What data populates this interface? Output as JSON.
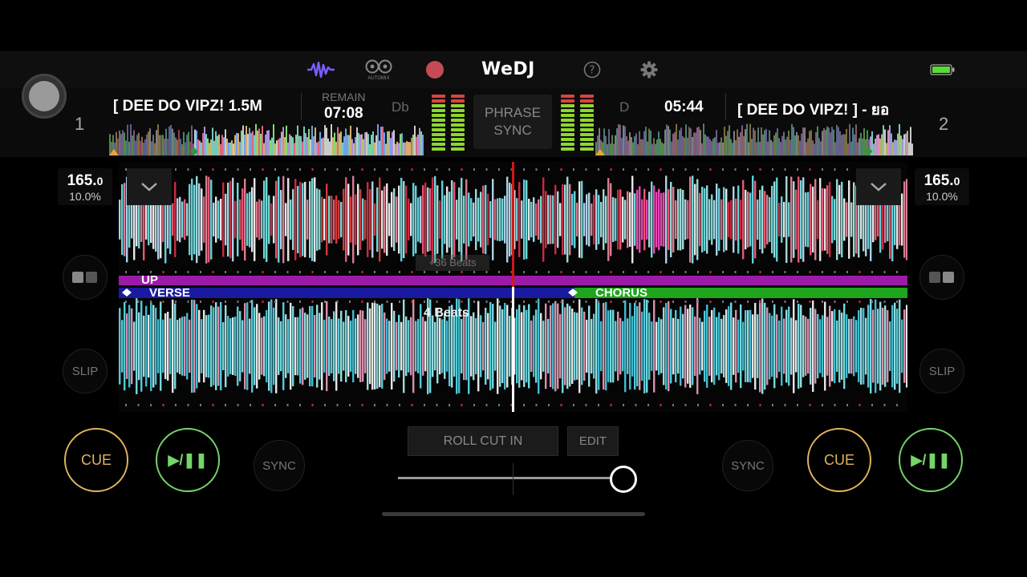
{
  "app": {
    "name": "WeDJ",
    "automix_label": "AUTOMIX"
  },
  "topbar": {
    "icons": [
      "waveform-icon",
      "automix-icon",
      "record-icon",
      "help-icon",
      "gear-icon",
      "battery-icon"
    ],
    "colors": {
      "waveform": "#7b5cff",
      "record": "#c44a56",
      "battery": "#59d93a"
    }
  },
  "deck1": {
    "number": "1",
    "title": "[ DEE DO VIPZ! 1.5M",
    "remain_label": "REMAIN",
    "remain_time": "07:08",
    "key": "Db",
    "bpm_main": "165.",
    "bpm_decimal": "0",
    "pitch": "10.0%",
    "cue_label": "CUE",
    "play_label": "▶/❚❚",
    "sync_label": "SYNC",
    "slip_label": "SLIP"
  },
  "deck2": {
    "number": "2",
    "title": "[ DEE DO VIPZ! ] - ยอ",
    "time": "05:44",
    "key": "D",
    "bpm_main": "165.",
    "bpm_decimal": "0",
    "pitch": "10.0%",
    "cue_label": "CUE",
    "play_label": "▶/❚❚",
    "sync_label": "SYNC",
    "slip_label": "SLIP"
  },
  "center": {
    "phrase_line1": "PHRASE",
    "phrase_line2": "SYNC",
    "roll_label": "ROLL CUT IN",
    "edit_label": "EDIT",
    "beats_label": "4 Beats",
    "ghost_beats": "+36 Beats",
    "crossfader_position": 0.99
  },
  "phrases": {
    "deck1": [
      {
        "label": "UP",
        "color": "#9b1aa8"
      }
    ],
    "deck2": [
      {
        "label": "VERSE",
        "color": "#1a1aa0"
      },
      {
        "label": "CHORUS",
        "color": "#1fa51c"
      }
    ]
  },
  "colors": {
    "cue": "#e0b45a",
    "play": "#75d56a",
    "playhead_top": "#d01818",
    "playhead_bottom": "#ffffff"
  }
}
